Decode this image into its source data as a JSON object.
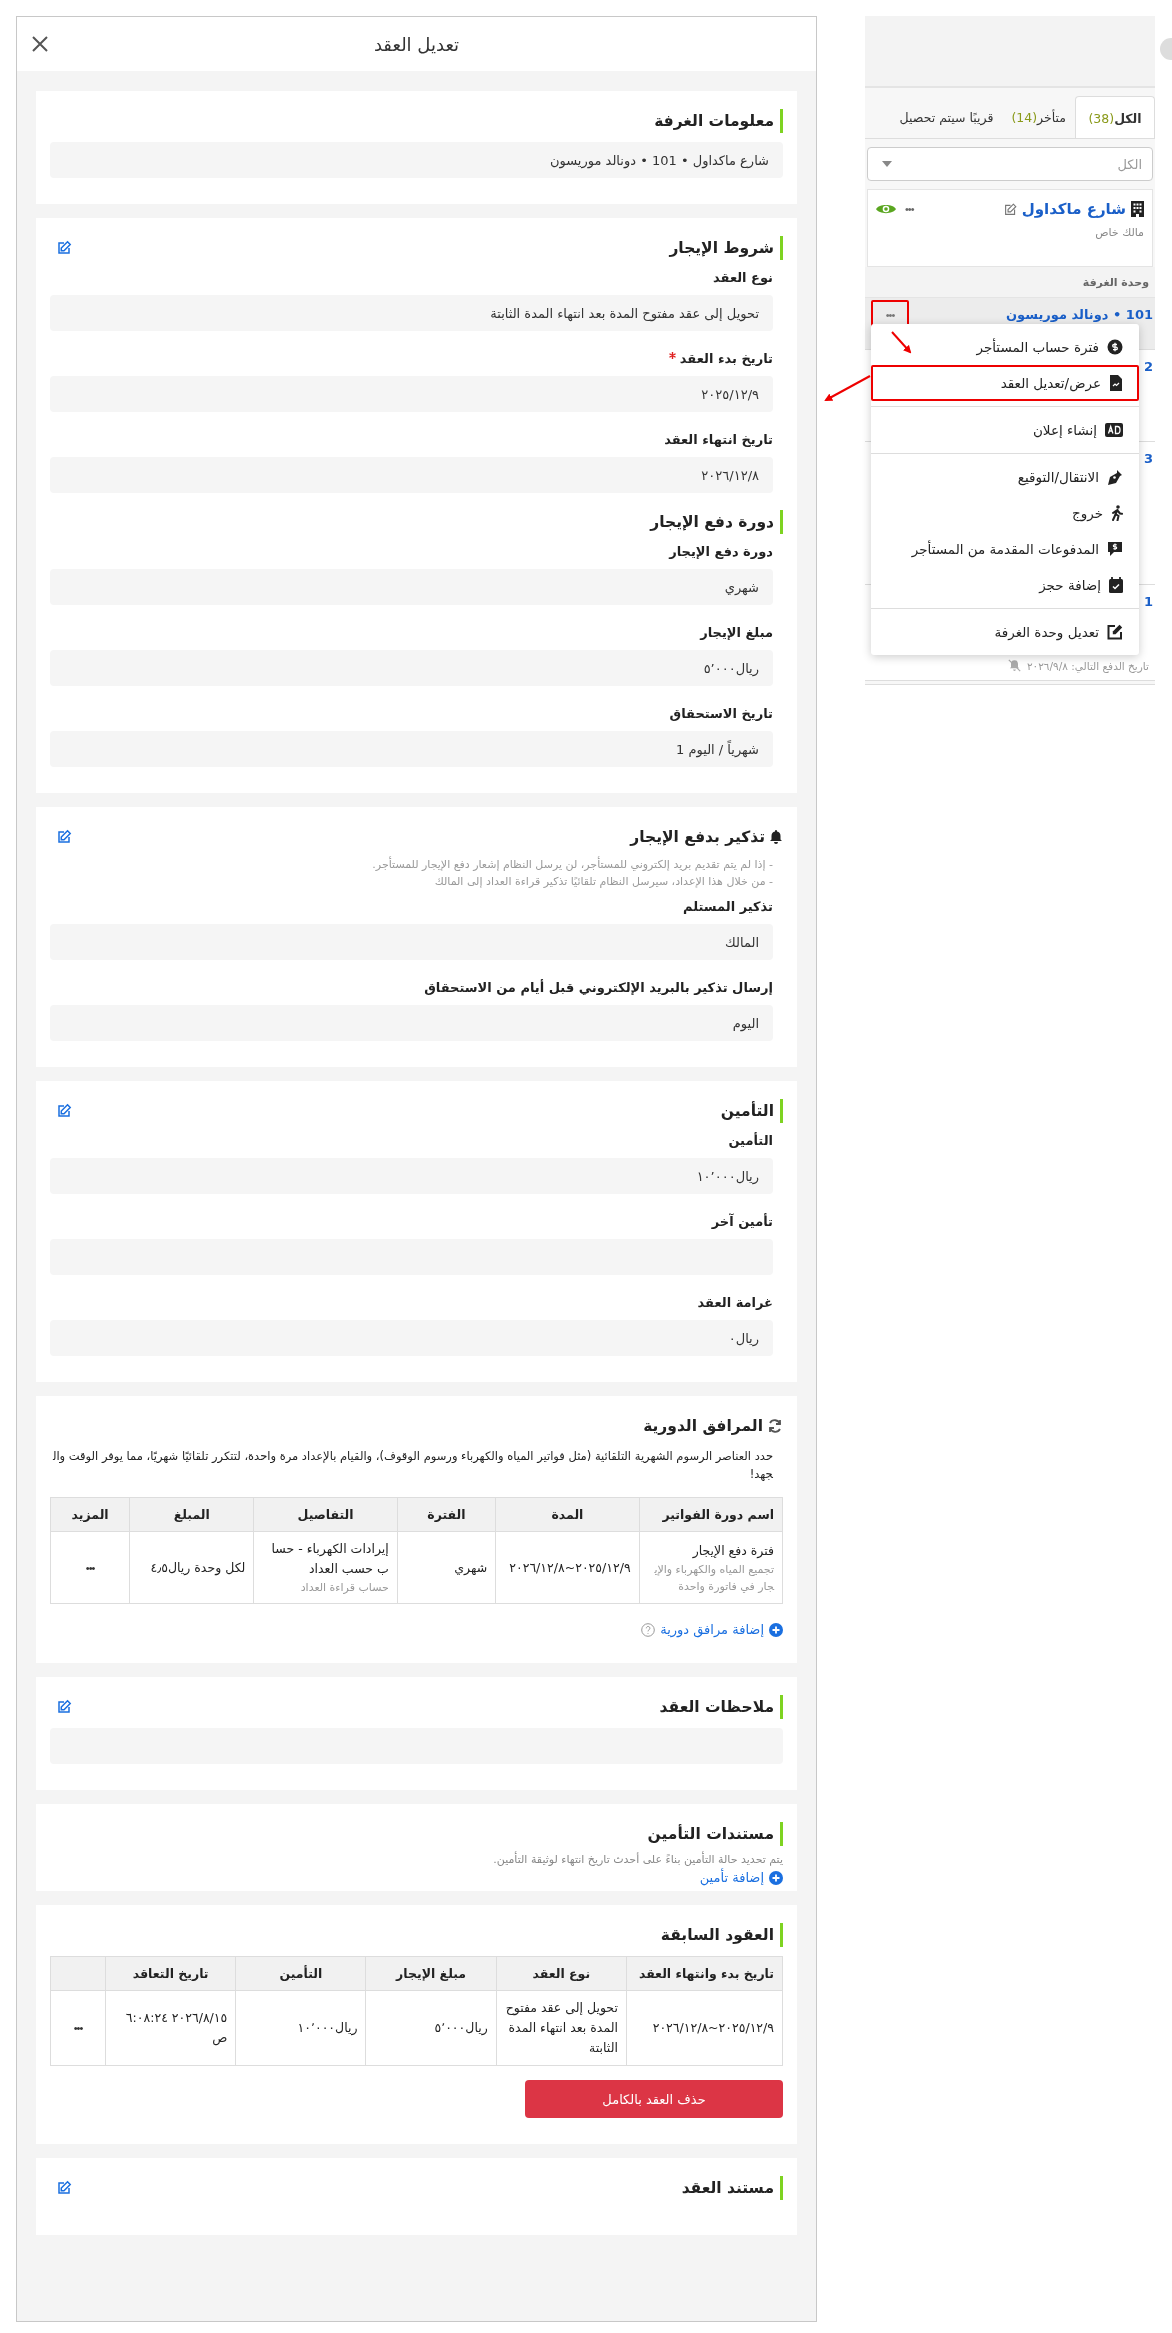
{
  "modal": {
    "title": "تعديل العقد"
  },
  "room_info": {
    "title": "معلومات الغرفة",
    "editable": false,
    "value": "شارع ماكداول • 101 • دونالد موريسون"
  },
  "lease_terms": {
    "title": "شروط الإيجار",
    "editable": true,
    "fields": [
      {
        "label": "نوع العقد",
        "required": false,
        "value": "تحويل إلى عقد مفتوح المدة بعد انتهاء المدة الثابتة"
      },
      {
        "label": "تاريخ بدء العقد",
        "required": true,
        "value": "٢٠٢٥/١٢/٩"
      },
      {
        "label": "تاريخ انتهاء العقد",
        "required": false,
        "value": "٢٠٢٦/١٢/٨"
      }
    ],
    "payment_cycle": {
      "title": "دورة دفع الإيجار",
      "fields": [
        {
          "label": "دورة دفع الإيجار",
          "required": false,
          "value": "شهري"
        },
        {
          "label": "مبلغ الإيجار",
          "required": false,
          "value": "ريال٥٬٠٠٠"
        },
        {
          "label": "تاريخ الاستحقاق",
          "required": false,
          "value": "شهرياً / اليوم 1"
        }
      ]
    }
  },
  "reminder": {
    "title": "تذكير بدفع الإيجار",
    "editable": true,
    "notes": [
      "- إذا لم يتم تقديم بريد إلكتروني للمستأجر، لن يرسل النظام إشعار دفع الإيجار للمستأجر.",
      "- من خلال هذا الإعداد، سيرسل النظام تلقائيًا تذكير قراءة العداد إلى المالك"
    ],
    "fields": [
      {
        "label": "تذكير المستلم",
        "required": false,
        "value": "المالك"
      },
      {
        "label": "إرسال تذكير بالبريد الإلكتروني قبل أيام من الاستحقاق",
        "required": false,
        "value": "اليوم"
      }
    ]
  },
  "insurance": {
    "title": "التأمين",
    "editable": true,
    "fields": [
      {
        "label": "التأمين",
        "required": false,
        "value": "ريال١٠٬٠٠٠"
      },
      {
        "label": "تأمين آخر",
        "required": false
      },
      {
        "label": "غرامة العقد",
        "required": false,
        "value": "ريال٠"
      }
    ]
  },
  "recurring": {
    "title": "المرافق الدورية",
    "editable": false,
    "description": "حدد العناصر الرسوم الشهرية التلقائية (مثل فواتير المياه والكهرباء ورسوم الوقوف)، والقيام بالإعداد مرة واحدة، لتتكرر تلقائيًا شهريًا، مما يوفر الوقت والجهد!",
    "columns": [
      "اسم دورة الفواتير",
      "المدة",
      "الفترة",
      "التفاصيل",
      "المبلغ",
      "المزيد"
    ],
    "rows": [
      {
        "name": "فترة دفع الإيجار",
        "name_note": "تجميع المياه والكهرباء والإيجار في فاتورة واحدة",
        "duration": "٢٠٢٥/١٢/٩~٢٠٢٦/١٢/٨",
        "period": "شهري",
        "details": "إيرادات الكهرباء - حساب حسب العداد",
        "details_note": "حساب قراءة العداد",
        "amount": "لكل وحدة ريال٤٫٥",
        "more": "•••"
      }
    ],
    "add_link": "إضافة مرافق دورية"
  },
  "contract_notes": {
    "title": "ملاحظات العقد",
    "editable": true
  },
  "insurance_docs": {
    "title": "مستندات التأمين",
    "editable": false,
    "note": "يتم تحديد حالة التأمين بناءً على أحدث تاريخ انتهاء لوثيقة التأمين.",
    "add_link": "إضافة تأمين"
  },
  "previous_contracts": {
    "title": "العقود السابقة",
    "editable": false,
    "columns": [
      "تاريخ بدء وانتهاء العقد",
      "نوع العقد",
      "مبلغ الإيجار",
      "التأمين",
      "تاريخ التعاقد"
    ],
    "rows": [
      {
        "period": "٢٠٢٥/١٢/٩~٢٠٢٦/١٢/٨",
        "type": "تحويل إلى عقد مفتوح المدة بعد انتهاء المدة الثابتة",
        "rent": "ريال٥٬٠٠٠",
        "deposit": "ريال١٠٬٠٠٠",
        "signed": "٢٠٢٦/٨/١٥ ٦:٠٨:٢٤ ص",
        "more": "•••"
      }
    ],
    "delete_button": "حذف العقد بالكامل"
  },
  "contract_document": {
    "title": "مستند العقد",
    "editable": true
  },
  "side_panel": {
    "tabs": [
      {
        "label": "الكل",
        "count": "(38)",
        "selected": true
      },
      {
        "label": "متأخر",
        "count": "(14)",
        "selected": false
      },
      {
        "label": "قريبًا سيتم تحصيل",
        "selected": false
      }
    ],
    "filter": {
      "placeholder": "الكل"
    },
    "property": {
      "name": "شارع ماكداول",
      "owner": "مالك خاص",
      "more": "•••"
    },
    "units_header": "وحدة الغرفة",
    "units": [
      {
        "title": "101 • دونالد موريسون",
        "selected": true,
        "more": "•••",
        "highlighted": true
      },
      {
        "title": "2",
        "selected": false
      },
      {
        "title": "3",
        "selected": false
      },
      {
        "title": "1",
        "selected": false,
        "next_payment": "تاريخ الدفع التالي: ٢٠٢٦/٩/٨"
      }
    ],
    "menu": {
      "groups": [
        [
          {
            "label": "فترة حساب المستأجر",
            "highlighted": false
          },
          {
            "label": "عرض/تعديل العقد",
            "highlighted": true
          }
        ],
        [
          {
            "label": "إنشاء إعلان",
            "highlighted": false
          }
        ],
        [
          {
            "label": "الانتقال/التوقيع",
            "highlighted": false
          },
          {
            "label": "خروج",
            "highlighted": false
          },
          {
            "label": "المدفوعات المقدمة من المستأجر",
            "highlighted": false
          },
          {
            "label": "إضافة حجز",
            "highlighted": false
          }
        ],
        [
          {
            "label": "تعديل وحدة الغرفة",
            "highlighted": false
          }
        ]
      ]
    }
  }
}
